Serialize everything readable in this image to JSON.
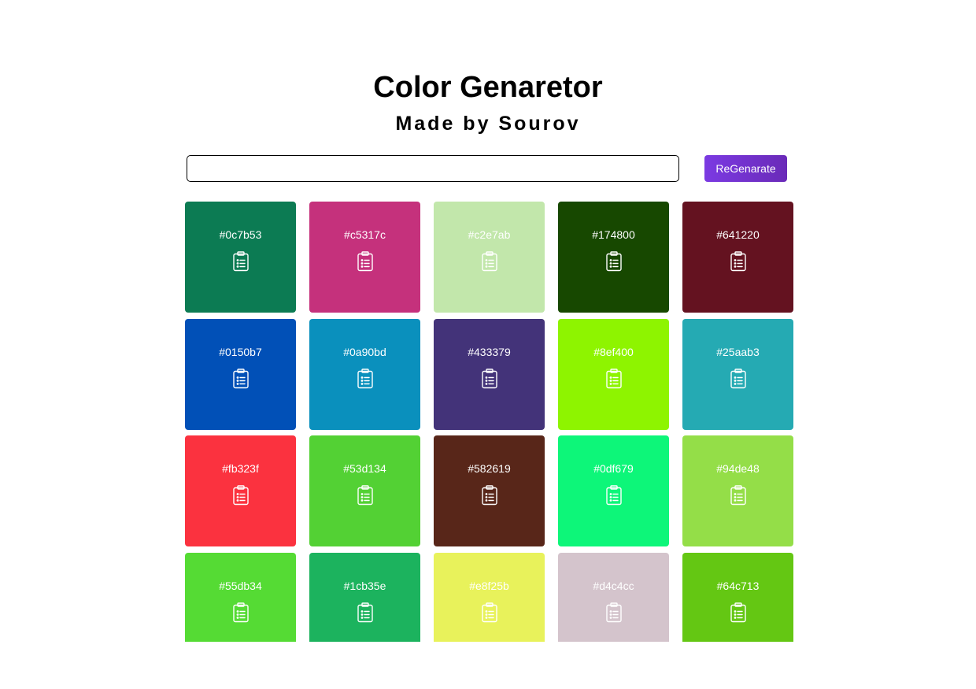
{
  "header": {
    "title": "Color Genaretor",
    "subtitle": "Made by Sourov"
  },
  "controls": {
    "input_value": "",
    "button_label": "ReGenarate"
  },
  "swatches": [
    {
      "hex": "#0c7b53"
    },
    {
      "hex": "#c5317c"
    },
    {
      "hex": "#c2e7ab"
    },
    {
      "hex": "#174800"
    },
    {
      "hex": "#641220"
    },
    {
      "hex": "#0150b7"
    },
    {
      "hex": "#0a90bd"
    },
    {
      "hex": "#433379"
    },
    {
      "hex": "#8ef400"
    },
    {
      "hex": "#25aab3"
    },
    {
      "hex": "#fb323f"
    },
    {
      "hex": "#53d134"
    },
    {
      "hex": "#582619"
    },
    {
      "hex": "#0df679"
    },
    {
      "hex": "#94de48"
    },
    {
      "hex": "#55db34"
    },
    {
      "hex": "#1cb35e"
    },
    {
      "hex": "#e8f25b"
    },
    {
      "hex": "#d4c4cc"
    },
    {
      "hex": "#64c713"
    }
  ],
  "icons": {
    "copy": "clipboard-list-icon"
  }
}
